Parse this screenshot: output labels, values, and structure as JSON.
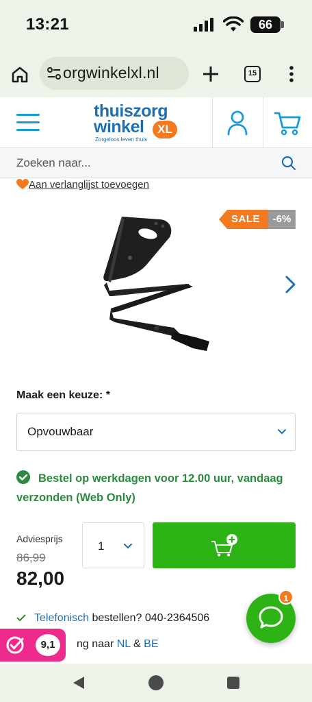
{
  "status_bar": {
    "time": "13:21",
    "battery": "66"
  },
  "browser": {
    "url": "orgwinkelxl.nl",
    "tab_count": "15"
  },
  "site": {
    "logo_line1": "thuiszorg",
    "logo_line2": "winkel",
    "logo_badge": "XL",
    "logo_tagline": "Zorgeloos leven thuis",
    "brand_blue": "#1e6fb0",
    "accent_orange": "#f47a1f",
    "accent_green": "#2eb317"
  },
  "search": {
    "placeholder": "Zoeken naar..."
  },
  "wishlist": {
    "label": "Aan verlanglijst toevoegen"
  },
  "product": {
    "sale_label": "SALE",
    "discount": "-6%",
    "choice_label": "Maak een keuze: *",
    "variant_selected": "Opvouwbaar",
    "delivery_text": "Bestel op werkdagen voor 12.00 uur, vandaag verzonden (Web Only)",
    "advies_label": "Adviesprijs",
    "old_price": "86,99",
    "new_price": "82,00",
    "quantity": "1"
  },
  "usp": {
    "phone_link": "Telefonisch",
    "phone_rest": " bestellen? 040-2364506",
    "ship_prefix": "ng naar ",
    "ship_nl": "NL",
    "ship_amp": " & ",
    "ship_be": "BE"
  },
  "rating": {
    "score": "9,1"
  },
  "chat": {
    "unread": "1"
  }
}
